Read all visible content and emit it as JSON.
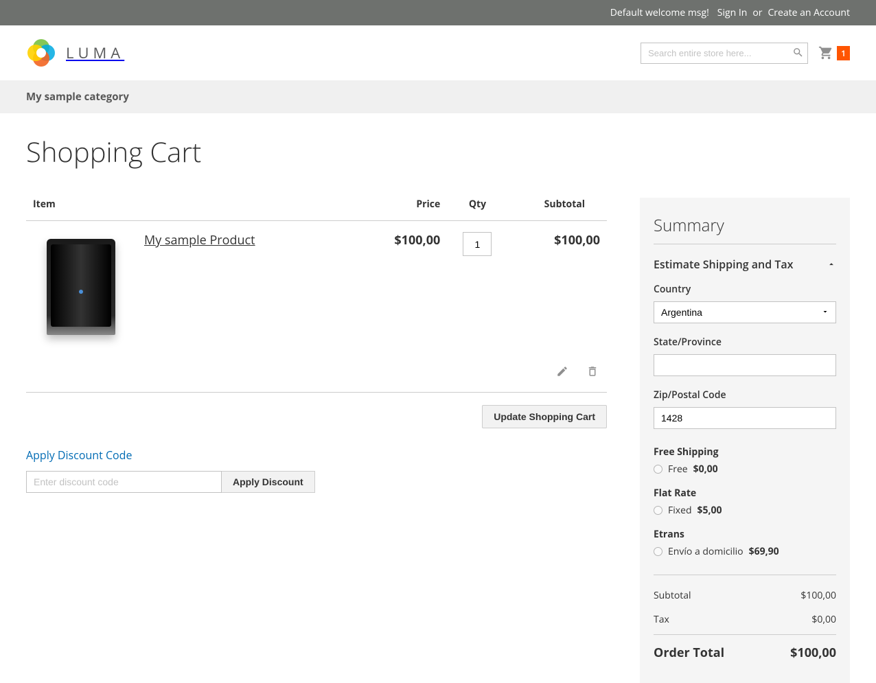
{
  "banner": {
    "welcome": "Default welcome msg!",
    "sign_in": "Sign In",
    "or": "or",
    "create_account": "Create an Account"
  },
  "header": {
    "logo_text": "LUMA",
    "search_placeholder": "Search entire store here...",
    "cart_count": "1"
  },
  "nav": {
    "category": "My sample category"
  },
  "page": {
    "title": "Shopping Cart"
  },
  "cart": {
    "columns": {
      "item": "Item",
      "price": "Price",
      "qty": "Qty",
      "subtotal": "Subtotal"
    },
    "items": [
      {
        "name": "My sample Product",
        "price": "$100,00",
        "qty": "1",
        "subtotal": "$100,00"
      }
    ],
    "update_button": "Update Shopping Cart"
  },
  "discount": {
    "toggle": "Apply Discount Code",
    "placeholder": "Enter discount code",
    "apply": "Apply Discount"
  },
  "summary": {
    "title": "Summary",
    "estimate_label": "Estimate Shipping and Tax",
    "country_label": "Country",
    "country_value": "Argentina",
    "state_label": "State/Province",
    "state_value": "",
    "zip_label": "Zip/Postal Code",
    "zip_value": "1428",
    "shipping_methods": [
      {
        "title": "Free Shipping",
        "option_label": "Free",
        "option_price": "$0,00"
      },
      {
        "title": "Flat Rate",
        "option_label": "Fixed",
        "option_price": "$5,00"
      },
      {
        "title": "Etrans",
        "option_label": "Envío a domicilio",
        "option_price": "$69,90"
      }
    ],
    "subtotal_label": "Subtotal",
    "subtotal_value": "$100,00",
    "tax_label": "Tax",
    "tax_value": "$0,00",
    "order_total_label": "Order Total",
    "order_total_value": "$100,00"
  }
}
